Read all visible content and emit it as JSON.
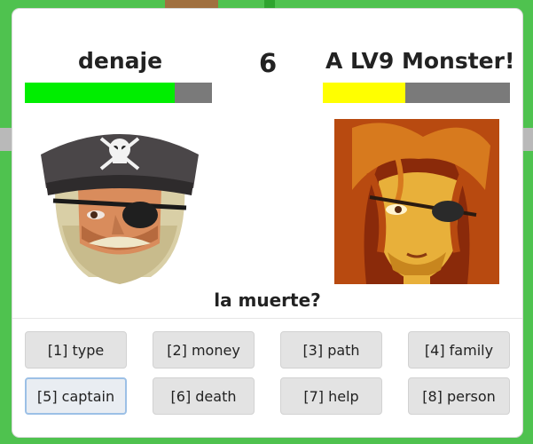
{
  "player": {
    "name": "denaje",
    "health_fraction": 0.8,
    "health_color": "#00ee00",
    "portrait": "pirate-captain-icon"
  },
  "opponent": {
    "name": "A LV9 Monster!",
    "health_fraction": 0.44,
    "health_color": "#ffff00",
    "portrait": "eyepatch-woman-icon"
  },
  "round": "6",
  "question": "la muerte?",
  "answers": [
    {
      "label": "[1] type"
    },
    {
      "label": "[2] money"
    },
    {
      "label": "[3] path"
    },
    {
      "label": "[4] family"
    },
    {
      "label": "[5] captain",
      "selected": true
    },
    {
      "label": "[6] death"
    },
    {
      "label": "[7] help"
    },
    {
      "label": "[8] person"
    }
  ],
  "colors": {
    "bar_background": "#7a7a7a",
    "selected_border": "#9cc0e6"
  }
}
